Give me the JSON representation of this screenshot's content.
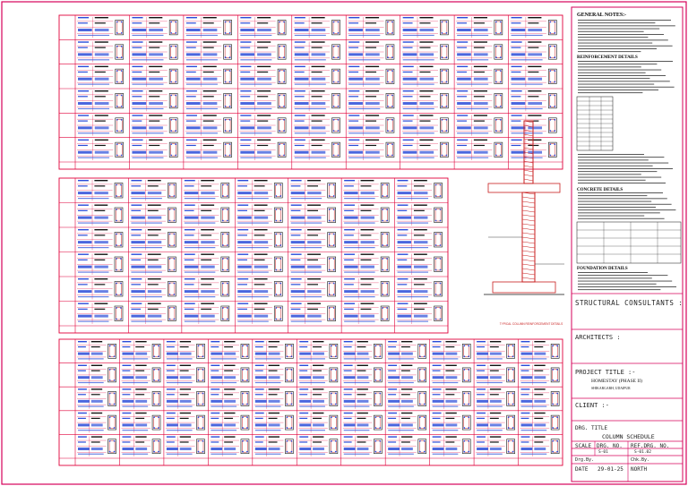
{
  "drawing": {
    "general_notes": {
      "title": "GENERAL NOTES:-",
      "reinforcement_title": "REINFORCEMENT DETAILS",
      "concrete_title": "CONCRETE DETAILS",
      "foundation_title": "FOUNDATION DETAILS"
    },
    "column_section_label": "TYPICAL COLUMN REINFORCEMENT DETAILS",
    "title_block": {
      "structural": "STRUCTURAL CONSULTANTS :",
      "architects": "ARCHITECTS :",
      "project_title_label": "PROJECT TITLE :-",
      "project_name": "HOMESTAY (PHASE II)",
      "project_location": "SHIKARGARH, UDAIPUR",
      "client_label": "CLIENT :-",
      "drg_title_label": "DRG. TITLE",
      "drg_title": "COLUMN SCHEDULE",
      "scale_label": "SCALE",
      "drg_no_label": "DRG. NO.",
      "ref_drg_label": "REF.DRG. NO.",
      "scale_value": "",
      "drg_no_value": "S-01",
      "ref_drg_value": "S-01.02",
      "drg_by_label": "Drg.By.",
      "chk_by_label": "Chk.By.",
      "date_label": "DATE",
      "date_value": "29-01-25",
      "north_label": "NORTH"
    }
  },
  "colors": {
    "border": "#d6005a",
    "grid": "#e0003a",
    "blue": "#2a4bd8",
    "black": "#111111",
    "column_steel": "#c81e1e"
  }
}
